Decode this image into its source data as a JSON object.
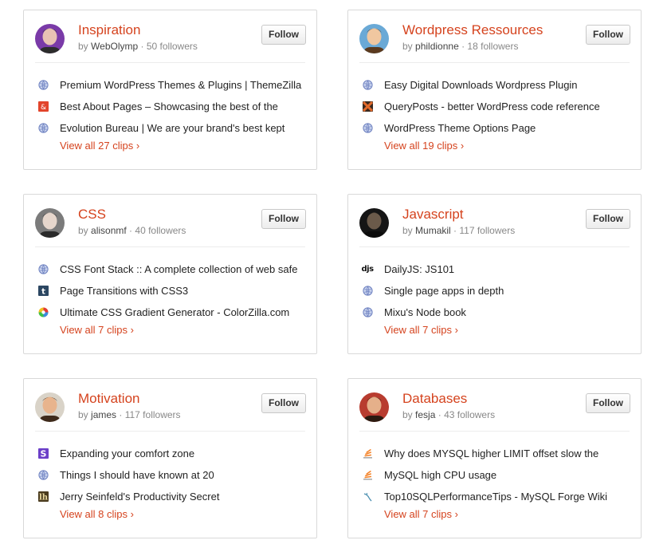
{
  "follow_label": "Follow",
  "by_label": "by",
  "cards": [
    {
      "title": "Inspiration",
      "owner": "WebOlymp",
      "followers": "50 followers",
      "clips": [
        {
          "icon": "globe-icon",
          "text": "Premium WordPress Themes & Plugins | ThemeZilla"
        },
        {
          "icon": "red-ampersand-icon",
          "text": "Best About Pages – Showcasing the best of the"
        },
        {
          "icon": "globe-icon",
          "text": "Evolution Bureau | We are your brand's best kept"
        }
      ],
      "view_all": "View all 27 clips ›"
    },
    {
      "title": "Wordpress Ressources",
      "owner": "phildionne",
      "followers": "18 followers",
      "clips": [
        {
          "icon": "globe-icon",
          "text": "Easy Digital Downloads Wordpress Plugin"
        },
        {
          "icon": "orange-square-icon",
          "text": "QueryPosts - better WordPress code reference"
        },
        {
          "icon": "globe-icon",
          "text": "WordPress Theme Options Page"
        }
      ],
      "view_all": "View all 19 clips ›"
    },
    {
      "title": "CSS",
      "owner": "alisonmf",
      "followers": "40 followers",
      "clips": [
        {
          "icon": "globe-icon",
          "text": "CSS Font Stack :: A complete collection of web safe"
        },
        {
          "icon": "tumblr-icon",
          "text": "Page Transitions with CSS3"
        },
        {
          "icon": "color-wheel-icon",
          "text": "Ultimate CSS Gradient Generator - ColorZilla.com"
        }
      ],
      "view_all": "View all 7 clips ›"
    },
    {
      "title": "Javascript",
      "owner": "Mumakil",
      "followers": "117 followers",
      "clips": [
        {
          "icon": "djs-icon",
          "icon_text": "djs",
          "text": "DailyJS: JS101"
        },
        {
          "icon": "globe-icon",
          "text": "Single page apps in depth"
        },
        {
          "icon": "globe-icon",
          "text": "Mixu's Node book"
        }
      ],
      "view_all": "View all 7 clips ›"
    },
    {
      "title": "Motivation",
      "owner": "james",
      "followers": "117 followers",
      "clips": [
        {
          "icon": "purple-s-icon",
          "text": "Expanding your comfort zone"
        },
        {
          "icon": "globe-icon",
          "text": "Things I should have known at 20"
        },
        {
          "icon": "lifehacker-icon",
          "text": "Jerry Seinfeld's Productivity Secret"
        }
      ],
      "view_all": "View all 8 clips ›"
    },
    {
      "title": "Databases",
      "owner": "fesja",
      "followers": "43 followers",
      "clips": [
        {
          "icon": "stack-icon",
          "text": "Why does MYSQL higher LIMIT offset slow the"
        },
        {
          "icon": "stack-icon",
          "text": "MySQL high CPU usage"
        },
        {
          "icon": "mysql-dolphin-icon",
          "text": "Top10SQLPerformanceTips - MySQL Forge Wiki"
        }
      ],
      "view_all": "View all 7 clips ›"
    }
  ]
}
